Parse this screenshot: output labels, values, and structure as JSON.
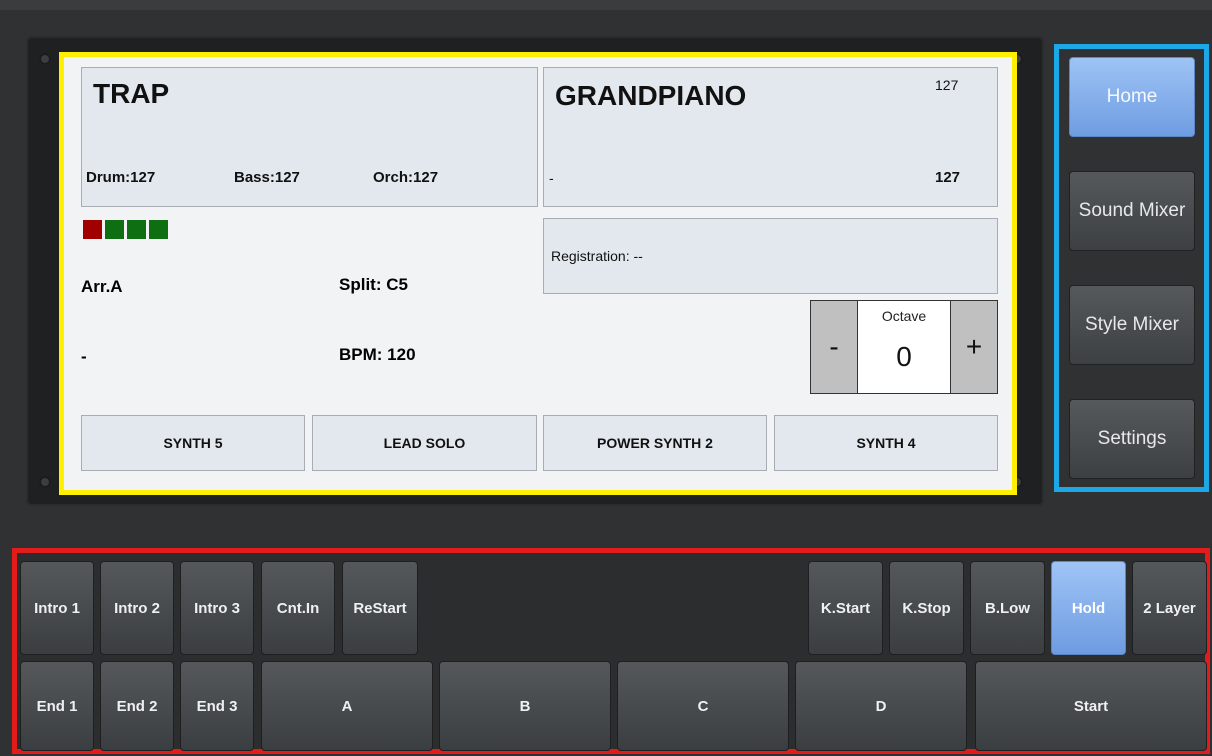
{
  "display": {
    "style": {
      "name": "TRAP",
      "drum": "Drum:127",
      "bass": "Bass:127",
      "orch": "Orch:127",
      "leds": [
        "#a00000",
        "#0e6e12",
        "#0e6e12",
        "#0e6e12"
      ],
      "arrangement": "Arr.A",
      "split": "Split: C5",
      "variation": "-",
      "bpm": "BPM: 120"
    },
    "voice": {
      "name": "GRANDPIANO",
      "volume_top": "127",
      "secondary": "-",
      "volume_bottom": "127"
    },
    "registration": "Registration: --",
    "octave": {
      "label": "Octave",
      "value": "0",
      "minus": "-",
      "plus": "+"
    },
    "voice_buttons": [
      "SYNTH 5",
      "LEAD SOLO",
      "POWER SYNTH 2",
      "SYNTH 4"
    ]
  },
  "nav": {
    "items": [
      {
        "label": "Home",
        "active": true
      },
      {
        "label": "Sound Mixer",
        "active": false
      },
      {
        "label": "Style Mixer",
        "active": false
      },
      {
        "label": "Settings",
        "active": false
      }
    ]
  },
  "controls": {
    "row1_left": [
      "Intro 1",
      "Intro 2",
      "Intro 3",
      "Cnt.In",
      "ReStart"
    ],
    "row1_right": [
      "K.Start",
      "K.Stop",
      "B.Low",
      "Hold",
      "2 Layer"
    ],
    "row2": [
      "End 1",
      "End 2",
      "End 3",
      "A",
      "B",
      "C",
      "D",
      "Start"
    ],
    "active": [
      "Hold"
    ]
  },
  "colors": {
    "display_frame": "#ffef00",
    "nav_frame": "#1ca7e6",
    "controls_frame": "#e21b1b",
    "active_button": "#8fb8ef"
  }
}
